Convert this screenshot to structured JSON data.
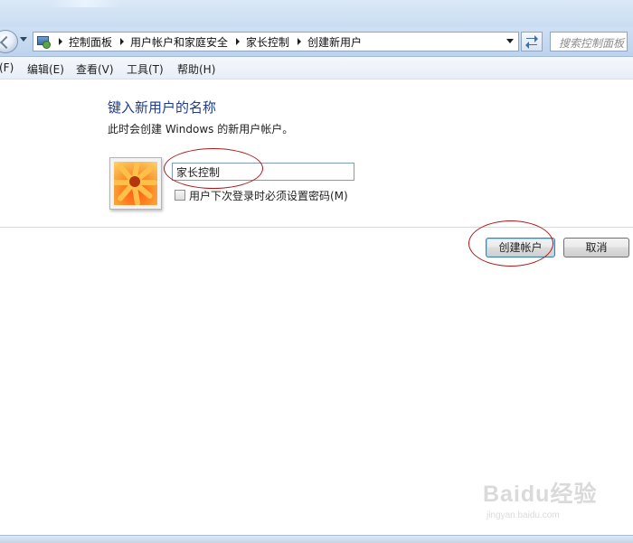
{
  "addressbar": {
    "breadcrumbs": [
      "控制面板",
      "用户帐户和家庭安全",
      "家长控制",
      "创建新用户"
    ]
  },
  "search": {
    "placeholder": "搜索控制面板"
  },
  "menu": [
    "(F)",
    "编辑(E)",
    "查看(V)",
    "工具(T)",
    "帮助(H)"
  ],
  "page": {
    "heading": "键入新用户的名称",
    "subtext": "此时会创建 Windows 的新用户帐户。",
    "name_value": "家长控制",
    "checkbox_label": "用户下次登录时必须设置密码(M)",
    "checkbox_checked": false
  },
  "buttons": {
    "create": "创建帐户",
    "cancel": "取消"
  },
  "annotation_color": "#b01818",
  "watermark": {
    "brand": "Baidu经验",
    "url": "jingyan.baidu.com"
  },
  "icons": [
    "back-arrow-icon",
    "history-dropdown-icon",
    "control-panel-icon",
    "refresh-icon",
    "user-picture-flower"
  ]
}
